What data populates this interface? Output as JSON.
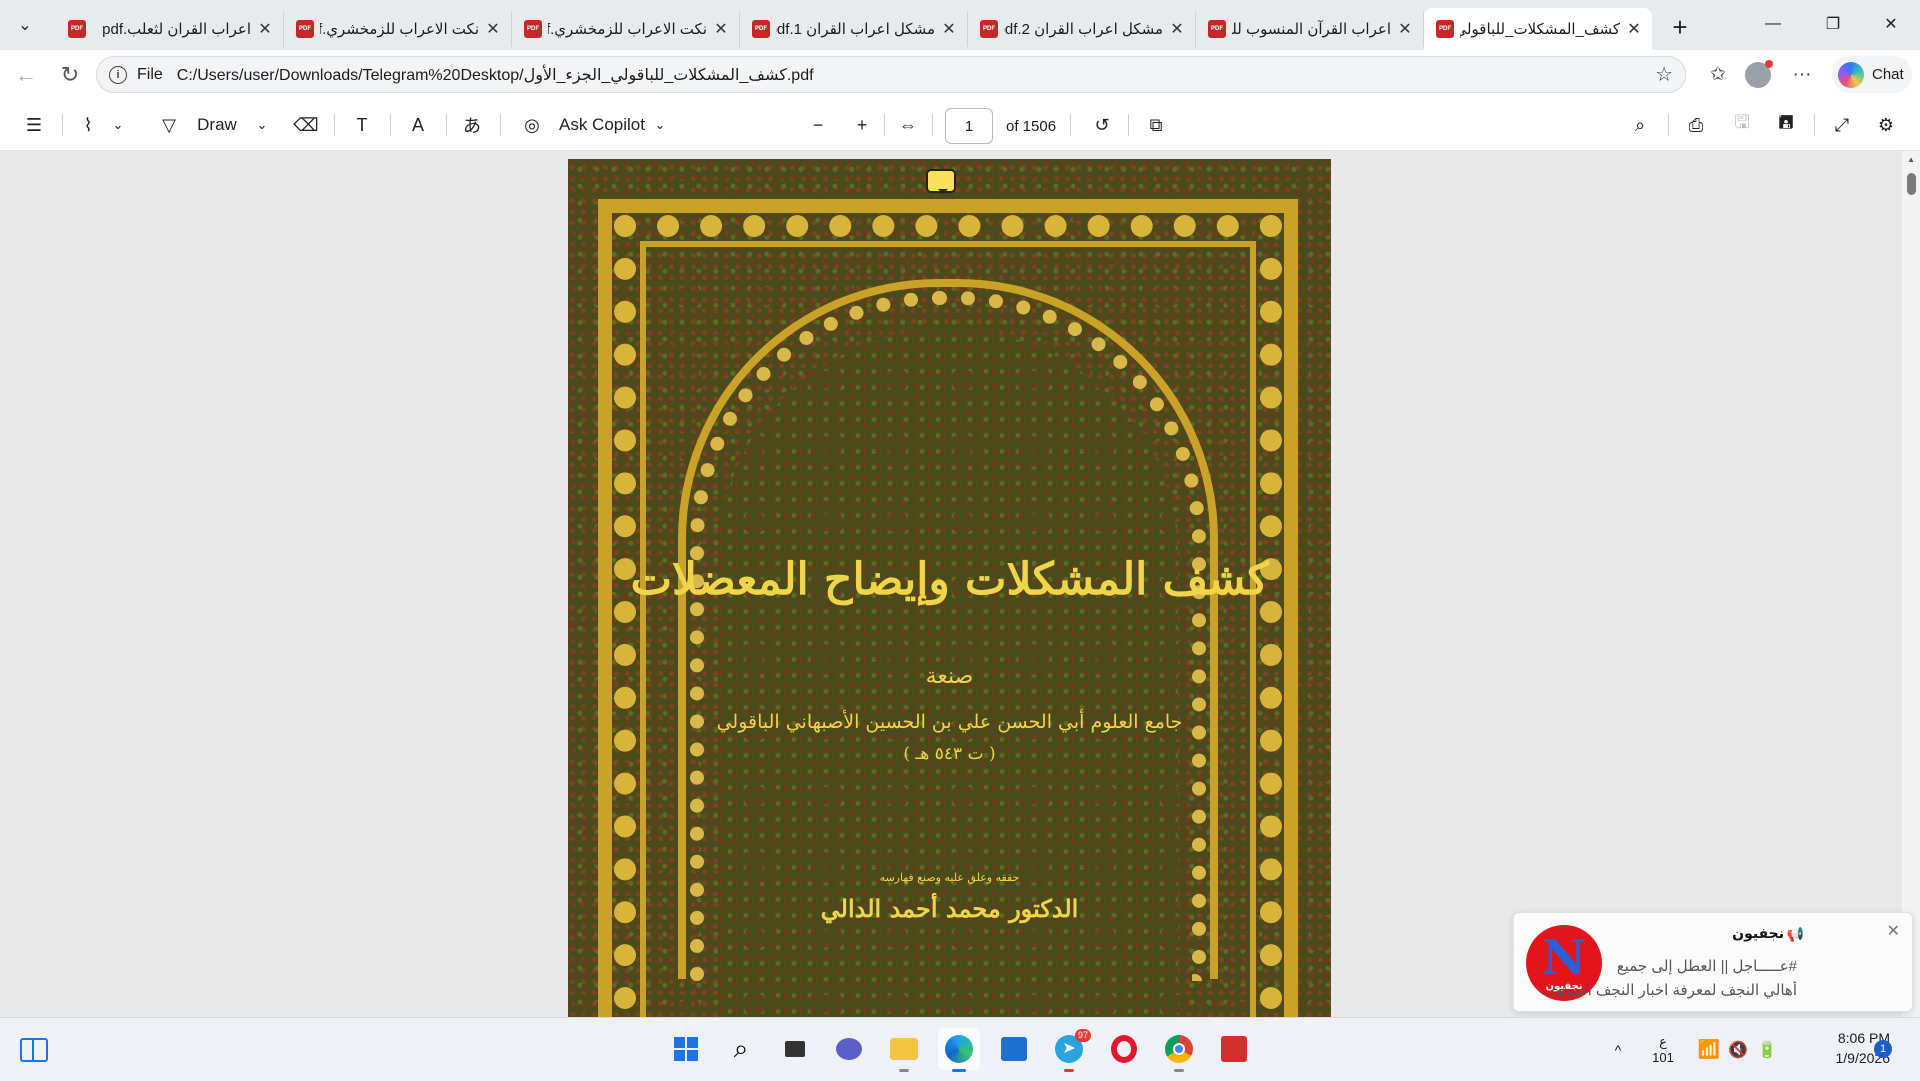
{
  "tabs": [
    {
      "title": "اعراب القران لثعلب.pdf"
    },
    {
      "title": "نكت الاعراب للزمخشري.pdf"
    },
    {
      "title": "نكت الاعراب للزمخشري.pdf"
    },
    {
      "title": "مشكل اعراب القران 1.pdf"
    },
    {
      "title": "مشكل اعراب القران 2.pdf"
    },
    {
      "title": "اعراب القرآن المنسوب للزجاج"
    },
    {
      "title": "كشف_المشكلات_للباقولي"
    }
  ],
  "window": {
    "minimize": "—",
    "restore": "❐",
    "close": "✕"
  },
  "address": {
    "scheme": "File",
    "url": "C:/Users/user/Downloads/Telegram%20Desktop/كشف_المشكلات_للباقولي_الجزء_الأول.pdf"
  },
  "chat_label": "Chat",
  "pdf_toolbar": {
    "draw_label": "Draw",
    "copilot_label": "Ask Copilot",
    "page_value": "1",
    "page_count": "of 1506"
  },
  "book": {
    "title": "كشف المشكلات وإيضاح المعضلات",
    "author_label": "صنعة",
    "author": "جامع العلوم أبي الحسن علي بن الحسين الأصبهاني الباقولي",
    "year": "( ت ٥٤٣ هـ )",
    "editor_label": "حققه وعلق عليه وصنع فهارسه",
    "editor": "الدكتور محمد أحمد الدالي"
  },
  "notification": {
    "app": "نجفيون",
    "logo_letter": "N",
    "logo_text": "نجفيون",
    "line1": "#عـــــاجل || العطل   إلى جميع",
    "line2": "أهالي النجف لمعرفة اخبار النجف الموثو..."
  },
  "taskbar": {
    "telegram_badge": "97",
    "lang_line1": "ع",
    "lang_line2": "101",
    "time": "8:06 PM",
    "date": "1/9/2026",
    "notif_count": "1"
  }
}
